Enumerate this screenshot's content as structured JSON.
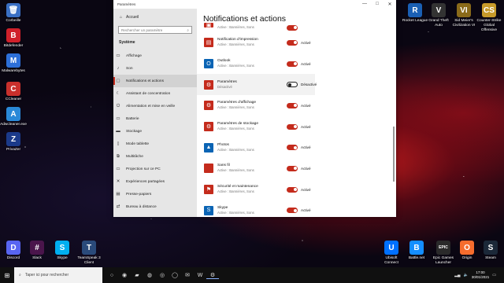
{
  "desktop": {
    "left_icons": [
      {
        "label": "Corbeille",
        "icon": "recycle-bin-icon",
        "color": "#3a6fc4",
        "glyph": "🗑"
      },
      {
        "label": "Bitdefender",
        "icon": "bitdefender-icon",
        "color": "#d0202a",
        "glyph": "B"
      },
      {
        "label": "Malwarebytes",
        "icon": "malwarebytes-icon",
        "color": "#2d6fd8",
        "glyph": "M"
      },
      {
        "label": "CCleaner",
        "icon": "ccleaner-icon",
        "color": "#c9302c",
        "glyph": "C"
      },
      {
        "label": "Adwcleaner.exe",
        "icon": "adwcleaner-icon",
        "color": "#2a89d8",
        "glyph": "A"
      },
      {
        "label": "PrivaZer",
        "icon": "privazer-icon",
        "color": "#1b3a8a",
        "glyph": "Z"
      }
    ],
    "right_icons": [
      {
        "label": "Rocket League",
        "icon": "rocket-league-icon",
        "color": "#1a5fb4",
        "glyph": "R"
      },
      {
        "label": "Grand Theft Auto",
        "icon": "gta-icon",
        "color": "#333333",
        "glyph": "V"
      },
      {
        "label": "Sid Meier's Civilization VI",
        "icon": "civilization-icon",
        "color": "#8a6a1a",
        "glyph": "VI"
      },
      {
        "label": "Counter-Strike Global Offensive",
        "icon": "csgo-icon",
        "color": "#c79a2a",
        "glyph": "CS"
      }
    ],
    "bottom_left_icons": [
      {
        "label": "Discord",
        "icon": "discord-icon",
        "color": "#5865f2",
        "glyph": "D"
      },
      {
        "label": "Slack",
        "icon": "slack-icon",
        "color": "#4a154b",
        "glyph": "#"
      },
      {
        "label": "Skype",
        "icon": "skype-icon",
        "color": "#00aff0",
        "glyph": "S"
      },
      {
        "label": "TeamSpeak 3 Client",
        "icon": "teamspeak-icon",
        "color": "#2a4a7a",
        "glyph": "T"
      }
    ],
    "bottom_right_icons": [
      {
        "label": "Ubisoft Connect",
        "icon": "ubisoft-icon",
        "color": "#0070ff",
        "glyph": "U"
      },
      {
        "label": "Battle.net",
        "icon": "battlenet-icon",
        "color": "#148eff",
        "glyph": "B"
      },
      {
        "label": "Epic Games Launcher",
        "icon": "epic-games-icon",
        "color": "#2a2a2a",
        "glyph": "EPIC"
      },
      {
        "label": "Origin",
        "icon": "origin-icon",
        "color": "#f56c2d",
        "glyph": "O"
      },
      {
        "label": "Steam",
        "icon": "steam-icon",
        "color": "#1b2838",
        "glyph": "S"
      }
    ]
  },
  "window": {
    "title": "Paramètres",
    "controls": [
      "—",
      "□",
      "✕"
    ],
    "nav": {
      "home": "Accueil",
      "search_placeholder": "Rechercher un paramètre",
      "section": "Système",
      "items": [
        {
          "label": "Affichage",
          "glyph": "▭"
        },
        {
          "label": "Son",
          "glyph": "♪"
        },
        {
          "label": "Notifications et actions",
          "glyph": "▢",
          "active": true
        },
        {
          "label": "Assistant de concentration",
          "glyph": "☾"
        },
        {
          "label": "Alimentation et mise en veille",
          "glyph": "⏻"
        },
        {
          "label": "Batterie",
          "glyph": "▭"
        },
        {
          "label": "Stockage",
          "glyph": "▬"
        },
        {
          "label": "Mode tablette",
          "glyph": "▯"
        },
        {
          "label": "Multitâche",
          "glyph": "⧉"
        },
        {
          "label": "Projection sur ce PC",
          "glyph": "▭"
        },
        {
          "label": "Expériences partagées",
          "glyph": "✕"
        },
        {
          "label": "Presse-papiers",
          "glyph": "▤"
        },
        {
          "label": "Bureau à distance",
          "glyph": "⇄"
        }
      ]
    },
    "content": {
      "title": "Notifications et actions",
      "rows": [
        {
          "name": "",
          "sub": "Active : Bannières, Sons",
          "toggle": "on",
          "state": "",
          "color": "#c42b1c",
          "glyph": "▣"
        },
        {
          "name": "Notification d'impression",
          "sub": "Active : Bannières, Sons",
          "toggle": "on",
          "state": "Activé",
          "color": "#c42b1c",
          "glyph": "▤"
        },
        {
          "name": "Outlook",
          "sub": "Active : Bannières, Sons",
          "toggle": "on",
          "state": "Activé",
          "color": "#0a64b4",
          "glyph": "O"
        },
        {
          "name": "Paramètres",
          "sub": "Désactivé",
          "toggle": "off",
          "state": "Désactivé",
          "color": "#c42b1c",
          "glyph": "⚙",
          "hover": true
        },
        {
          "name": "Paramètres d'affichage",
          "sub": "Active : Bannières, Sons",
          "toggle": "on",
          "state": "Activé",
          "color": "#c42b1c",
          "glyph": "⚙"
        },
        {
          "name": "Paramètres de stockage",
          "sub": "Active : Bannières, Sons",
          "toggle": "on",
          "state": "Activé",
          "color": "#c42b1c",
          "glyph": "⚙"
        },
        {
          "name": "Photos",
          "sub": "Active : Bannières, Sons",
          "toggle": "on",
          "state": "Activé",
          "color": "#0a64b4",
          "glyph": "▲"
        },
        {
          "name": "Sans fil",
          "sub": "Active : Bannières, Sons",
          "toggle": "on",
          "state": "Activé",
          "color": "#c42b1c",
          "glyph": ""
        },
        {
          "name": "Sécurité et maintenance",
          "sub": "Active : Bannières, Sons",
          "toggle": "on",
          "state": "Activé",
          "color": "#c42b1c",
          "glyph": "⚑"
        },
        {
          "name": "Skype",
          "sub": "Active : Bannières, Sons",
          "toggle": "on",
          "state": "Activé",
          "color": "#0a64b4",
          "glyph": "S"
        }
      ]
    }
  },
  "taskbar": {
    "start_glyph": "⊞",
    "search_placeholder": "Taper ici pour rechercher",
    "apps": [
      {
        "name": "task-view-icon",
        "glyph": "○"
      },
      {
        "name": "edge-icon",
        "glyph": "◉"
      },
      {
        "name": "file-explorer-icon",
        "glyph": "▰"
      },
      {
        "name": "firefox-icon",
        "glyph": "◍"
      },
      {
        "name": "chrome-icon",
        "glyph": "◎"
      },
      {
        "name": "opera-icon",
        "glyph": "◯"
      },
      {
        "name": "mail-icon",
        "glyph": "✉"
      },
      {
        "name": "word-icon",
        "glyph": "W"
      },
      {
        "name": "settings-icon",
        "glyph": "⚙",
        "active": true
      }
    ],
    "time": "17:00",
    "date": "30/01/2021"
  }
}
